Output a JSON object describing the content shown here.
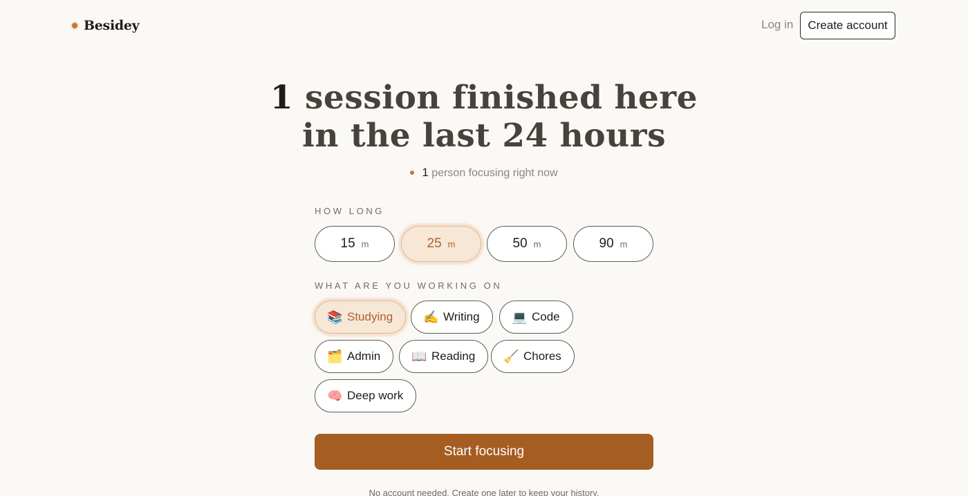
{
  "header": {
    "brand": "Besidey",
    "login_label": "Log in",
    "create_account_label": "Create account"
  },
  "hero": {
    "count": "1",
    "line1_rest": "session finished here",
    "line2": "in the last 24 hours",
    "live_count": "1",
    "live_text": "person focusing right now"
  },
  "duration": {
    "label": "HOW LONG",
    "options": [
      {
        "value": "15",
        "unit": "m",
        "selected": false
      },
      {
        "value": "25",
        "unit": "m",
        "selected": true
      },
      {
        "value": "50",
        "unit": "m",
        "selected": false
      },
      {
        "value": "90",
        "unit": "m",
        "selected": false
      }
    ]
  },
  "categories": {
    "label": "WHAT ARE YOU WORKING ON",
    "options": [
      {
        "icon": "books-icon",
        "glyph": "📚",
        "label": "Studying",
        "selected": true
      },
      {
        "icon": "writing-hand-icon",
        "glyph": "✍️",
        "label": "Writing",
        "selected": false
      },
      {
        "icon": "laptop-icon",
        "glyph": "💻",
        "label": "Code",
        "selected": false
      },
      {
        "icon": "card-index-icon",
        "glyph": "🗂️",
        "label": "Admin",
        "selected": false
      },
      {
        "icon": "open-book-icon",
        "glyph": "📖",
        "label": "Reading",
        "selected": false
      },
      {
        "icon": "broom-icon",
        "glyph": "🧹",
        "label": "Chores",
        "selected": false
      },
      {
        "icon": "brain-icon",
        "glyph": "🧠",
        "label": "Deep work",
        "selected": false
      }
    ]
  },
  "cta": {
    "start_label": "Start focusing",
    "footnote": "No account needed. Create one later to keep your history."
  },
  "colors": {
    "accent": "#a65d22",
    "accent_text": "#b0622a",
    "selected_bg": "#f6e7d6",
    "background": "#fbf9f6"
  }
}
